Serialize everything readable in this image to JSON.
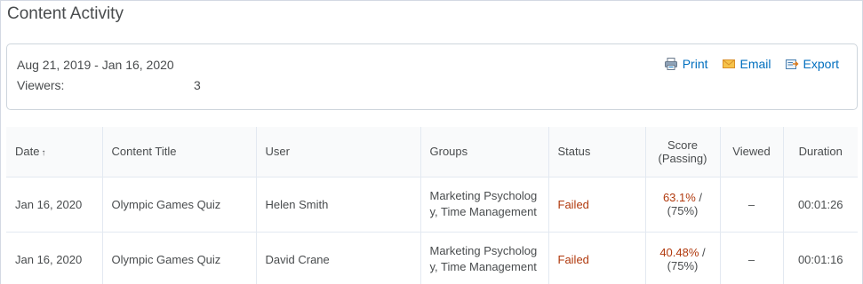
{
  "page": {
    "title": "Content Activity"
  },
  "summary": {
    "date_range": "Aug 21, 2019 - Jan 16, 2020",
    "viewers_label": "Viewers:",
    "viewers_count": "3"
  },
  "actions": {
    "print_label": "Print",
    "email_label": "Email",
    "export_label": "Export"
  },
  "table": {
    "headers": {
      "date": "Date",
      "sort_indicator": "↑",
      "content_title": "Content Title",
      "user": "User",
      "groups": "Groups",
      "status": "Status",
      "score_line1": "Score",
      "score_line2": "(Passing)",
      "viewed": "Viewed",
      "duration": "Duration"
    },
    "rows": [
      {
        "date": "Jan 16, 2020",
        "content_title": "Olympic Games Quiz",
        "user": "Helen Smith",
        "groups": "Marketing Psychology, Time Management",
        "status": "Failed",
        "score": "63.1%",
        "score_sep": " /",
        "passing": "(75%)",
        "viewed": "–",
        "duration": "00:01:26"
      },
      {
        "date": "Jan 16, 2020",
        "content_title": "Olympic Games Quiz",
        "user": "David Crane",
        "groups": "Marketing Psychology, Time Management",
        "status": "Failed",
        "score": "40.48%",
        "score_sep": " /",
        "passing": "(75%)",
        "viewed": "–",
        "duration": "00:01:16"
      }
    ]
  },
  "colors": {
    "link": "#006fbf",
    "failed": "#b13a0e",
    "border": "#e3e9f1"
  }
}
